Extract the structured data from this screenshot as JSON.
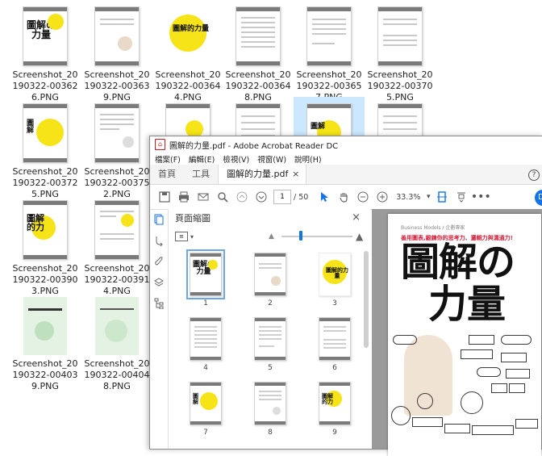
{
  "files": [
    {
      "name": "Screenshot_20190322-003626.PNG"
    },
    {
      "name": "Screenshot_20190322-003639.PNG"
    },
    {
      "name": "Screenshot_20190322-003644.PNG"
    },
    {
      "name": "Screenshot_20190322-003648.PNG"
    },
    {
      "name": "Screenshot_20190322-003657.PNG"
    },
    {
      "name": "Screenshot_20190322-003705.PNG"
    },
    {
      "name": "Screenshot_20190322-003725.PNG"
    },
    {
      "name": "Screenshot_20190322-003752.PNG"
    },
    {
      "name": "Screenshot_20190322-003903.PNG"
    },
    {
      "name": "Screenshot_20190322-003914.PNG"
    },
    {
      "name": "Screenshot_20190322-004039.PNG"
    },
    {
      "name": "Screenshot_20190322-004048.PNG"
    }
  ],
  "acrobat": {
    "title": "圖解的力量.pdf - Adobe Acrobat Reader DC",
    "menu": [
      "檔案(F)",
      "編輯(E)",
      "檢視(V)",
      "視窗(W)",
      "說明(H)"
    ],
    "tabs": {
      "home": "首頁",
      "tools": "工具",
      "doc": "圖解的力量.pdf"
    },
    "toolbar": {
      "page_current": "1",
      "page_total": "/ 50",
      "zoom": "33.3%"
    },
    "panel": {
      "title": "頁面縮圖"
    },
    "thumbnails": [
      "1",
      "2",
      "3",
      "4",
      "5",
      "6",
      "7",
      "8",
      "9"
    ],
    "page": {
      "kicker": "Business Models / 企劃專家",
      "subtitle": "善用圖表,鍛鍊你的思考力、邏輯力與溝通力!",
      "title_line1": "圖解の",
      "title_line2": "力量"
    }
  },
  "colors": {
    "accent": "#1473e6",
    "yellow": "#f6e418",
    "selection": "#cce8ff"
  }
}
